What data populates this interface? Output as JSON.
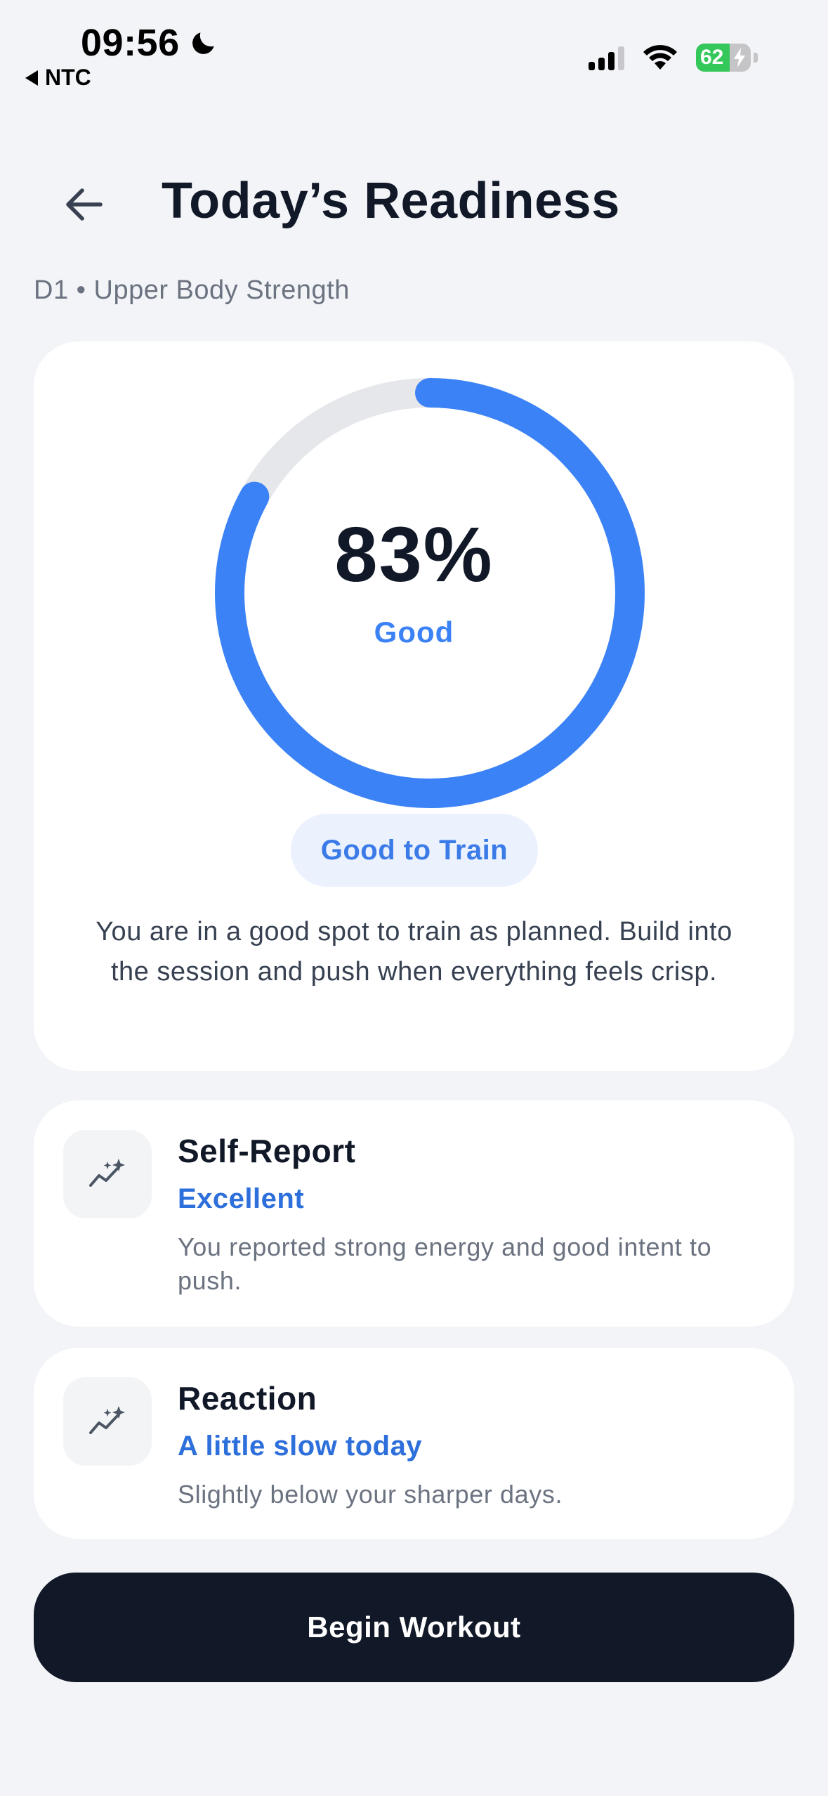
{
  "status_bar": {
    "time": "09:56",
    "back_app": "NTC",
    "battery": "62",
    "icons": [
      "moon-icon",
      "cellular-signal-icon",
      "wifi-icon",
      "battery-charging-icon"
    ]
  },
  "header": {
    "back_icon": "arrow-left-icon",
    "title": "Today’s Readiness",
    "subtitle": "D1 • Upper Body Strength"
  },
  "readiness": {
    "score": "83%",
    "score_value": 0.83,
    "label": "Good",
    "badge": "Good to Train",
    "description": "You are in a good spot to train as planned. Build into the session and push when everything feels crisp.",
    "colors": {
      "ring": "#3b82f6",
      "track": "#e5e7eb",
      "label": "#3b82f6"
    }
  },
  "metrics": [
    {
      "icon": "sparkle-trend-icon",
      "title": "Self-Report",
      "status": "Excellent",
      "description": "You reported strong energy and good intent to push."
    },
    {
      "icon": "sparkle-trend-icon",
      "title": "Reaction",
      "status": "A little slow today",
      "description": "Slightly below your sharper days."
    }
  ],
  "actions": {
    "begin_label": "Begin Workout"
  }
}
